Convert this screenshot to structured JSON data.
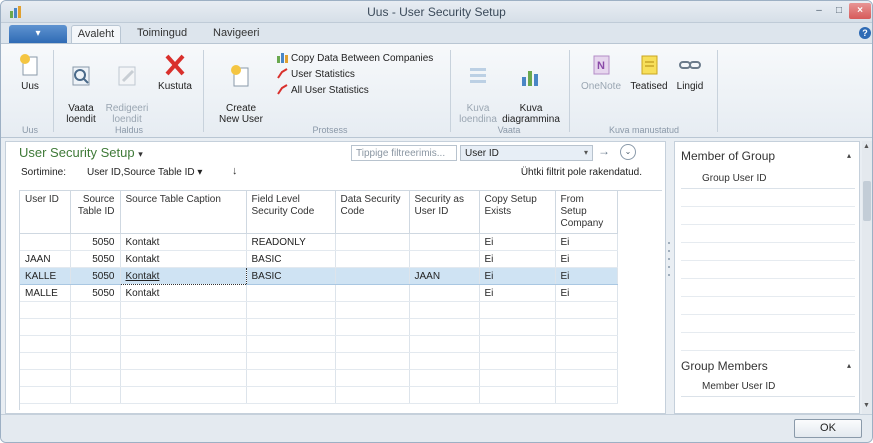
{
  "window": {
    "title": "Uus - User Security Setup",
    "minimize_glyph": "–",
    "maximize_glyph": "□",
    "close_glyph": "×",
    "help_glyph": "?"
  },
  "ribbon_tabs": {
    "file": "▾",
    "avaleht": "Avaleht",
    "toimingud": "Toimingud",
    "navigeeri": "Navigeeri"
  },
  "ribbon": {
    "uus": "Uus",
    "vaata_loendit": "Vaata\nloendit",
    "redigeeri_loendit": "Redigeeri\nloendit",
    "kustuta": "Kustuta",
    "create_new_user": "Create\nNew User",
    "copy_data": "Copy Data Between Companies",
    "user_statistics": "User Statistics",
    "all_user_statistics": "All User Statistics",
    "kuva_loendina": "Kuva\nloendina",
    "kuva_diagrammina": "Kuva\ndiagrammina",
    "onenote": "OneNote",
    "teatised": "Teatised",
    "lingid": "Lingid",
    "group_uus": "Uus",
    "group_haldus": "Haldus",
    "group_protsess": "Protsess",
    "group_vaata": "Vaata",
    "group_kuva_manustatud": "Kuva manustatud"
  },
  "page": {
    "title": "User Security Setup",
    "title_dropdown": "▾",
    "filter_placeholder": "Tippige filtreerimis...",
    "filter_field": "User ID",
    "filter_field_dd": "▾",
    "go_glyph": "→",
    "expand_glyph": "⌄",
    "sort_label": "Sortimine:",
    "sort_value": "User ID,Source Table ID ▾",
    "sort_dir": "↓",
    "filter_note": "Ühtki filtrit pole rakendatud."
  },
  "table": {
    "columns": [
      "User ID",
      "Source Table ID",
      "Source Table Caption",
      "Field Level Security Code",
      "Data Security Code",
      "Security as User ID",
      "Copy Setup Exists",
      "From Setup Company"
    ],
    "rows": [
      [
        "",
        "5050",
        "Kontakt",
        "READONLY",
        "",
        "",
        "Ei",
        "Ei"
      ],
      [
        "JAAN",
        "5050",
        "Kontakt",
        "BASIC",
        "",
        "",
        "Ei",
        "Ei"
      ],
      [
        "KALLE",
        "5050",
        "Kontakt",
        "BASIC",
        "",
        "JAAN",
        "Ei",
        "Ei"
      ],
      [
        "MALLE",
        "5050",
        "Kontakt",
        "",
        "",
        "",
        "Ei",
        "Ei"
      ]
    ],
    "selected_row": 2
  },
  "factboxes": {
    "member_of_group": "Member of Group",
    "group_user_id": "Group User ID",
    "group_members": "Group Members",
    "member_user_id": "Member User ID",
    "collapse_glyph": "▴"
  },
  "footer": {
    "ok": "OK"
  },
  "colors": {
    "page_title": "#3f7a38",
    "selected_row": "#cfe3f3",
    "file_tab": "#2f6bb5",
    "close_button": "#d65a5a"
  }
}
